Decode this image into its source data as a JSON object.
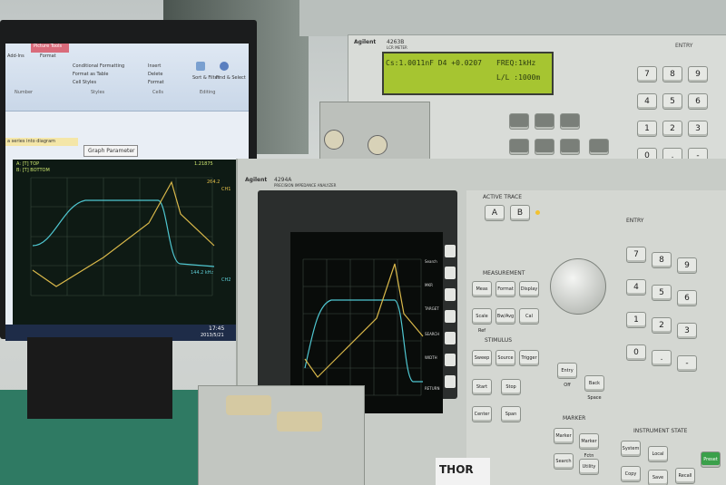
{
  "excel": {
    "ribbon_tab": "Picture Tools",
    "ribbon_subtab": "Format",
    "tab_addins": "Add-Ins",
    "group_conditional": "Conditional Formatting",
    "group_format_table": "Format as Table",
    "group_cell_styles": "Cell Styles",
    "group_styles": "Styles",
    "group_insert": "Insert",
    "group_delete": "Delete",
    "group_format": "Format",
    "group_cells": "Cells",
    "group_sort": "Sort & Filter",
    "group_find": "Find & Select",
    "group_editing": "Editing",
    "group_number": "Number",
    "button_graph_params": "Graph Parameter",
    "banner_text": "a series into diagram",
    "plot_header_left": "A: [T] TOP",
    "plot_header_bottom": "B: [T] BOTTOM",
    "plot_header_top_val": "1.21875",
    "plot_ch1_val": "264.2",
    "plot_ch1": "CH1",
    "plot_ch2": "CH2",
    "plot_ch2_val": "144.2 kHz",
    "time": "17:45",
    "date": "2013/5/21"
  },
  "lcr_meter": {
    "brand": "Agilent",
    "model": "4263B",
    "model_desc": "LCR METER",
    "lcd_line1": "Cs:1.0011nF D4 +0.0207",
    "lcd_line1b": "FREQ:1kHz",
    "lcd_line2": "L/L :1000m",
    "entry_label": "ENTRY",
    "keys": [
      "7",
      "8",
      "9",
      "4",
      "5",
      "6",
      "1",
      "2",
      "3",
      "0",
      ".",
      "-"
    ]
  },
  "vna": {
    "brand": "Agilent",
    "model": "4294A",
    "model_desc": "PRECISION IMPEDANCE ANALYZER",
    "active_trace": "ACTIVE TRACE",
    "key_a": "A",
    "key_b": "B",
    "measurement": "MEASUREMENT",
    "stimulus": "STIMULUS",
    "marker": "MARKER",
    "instrument_state": "INSTRUMENT STATE",
    "entry_label": "ENTRY",
    "keys_num": [
      "7",
      "8",
      "9",
      "4",
      "5",
      "6",
      "1",
      "2",
      "3",
      "0",
      ".",
      "-"
    ],
    "meas_keys": [
      "Meas",
      "Format",
      "Display",
      "Scale Ref",
      "Bw/Avg",
      "Cal"
    ],
    "stim_keys": [
      "Sweep",
      "Source",
      "Trigger",
      "Start",
      "Stop",
      "Center",
      "Span"
    ],
    "entry_keys": [
      "Entry Off",
      "Back Space"
    ],
    "marker_keys": [
      "Marker",
      "Marker Fctn",
      "Search",
      "Utility"
    ],
    "inst_keys": [
      "System",
      "Local",
      "Copy",
      "Save",
      "Recall",
      "Preset"
    ],
    "softkeys": [
      "Search",
      "MKR",
      "TARGET",
      "SEARCH",
      "WIDTH",
      "RETURN"
    ]
  },
  "thor_label": "THOR"
}
